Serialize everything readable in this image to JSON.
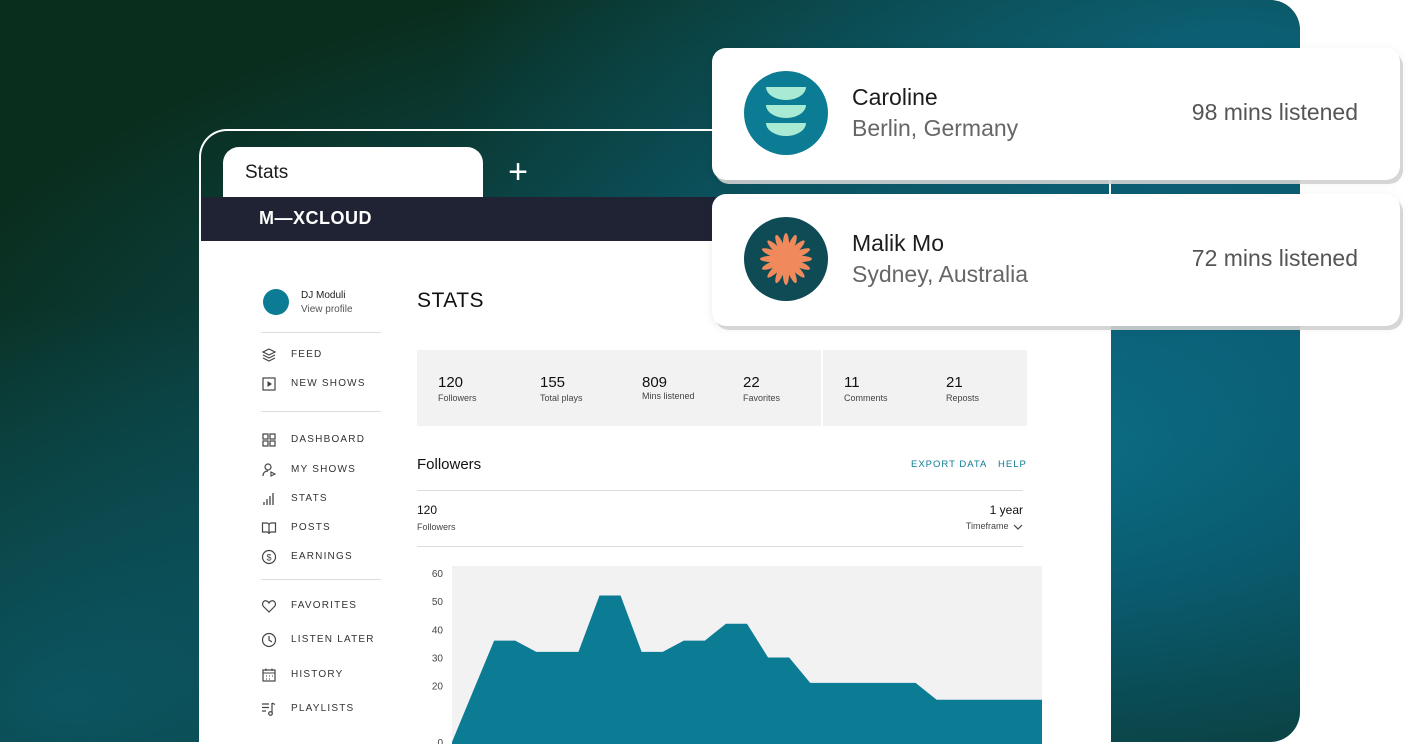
{
  "browser": {
    "tab_title": "Stats",
    "new_tab_symbol": "+"
  },
  "brand": {
    "logo_text": "M—XCLOUD"
  },
  "profile": {
    "name": "DJ Moduli",
    "link": "View profile"
  },
  "nav": {
    "group1": [
      {
        "label": "FEED",
        "icon": "layers-icon"
      },
      {
        "label": "NEW SHOWS",
        "icon": "play-square-icon"
      }
    ],
    "group2": [
      {
        "label": "DASHBOARD",
        "icon": "grid-icon"
      },
      {
        "label": "MY SHOWS",
        "icon": "user-play-icon"
      },
      {
        "label": "STATS",
        "icon": "bar-chart-icon"
      },
      {
        "label": "POSTS",
        "icon": "book-icon"
      },
      {
        "label": "EARNINGS",
        "icon": "dollar-circle-icon"
      }
    ],
    "group3": [
      {
        "label": "FAVORITES",
        "icon": "heart-icon"
      },
      {
        "label": "LISTEN LATER",
        "icon": "clock-icon"
      },
      {
        "label": "HISTORY",
        "icon": "calendar-icon"
      },
      {
        "label": "PLAYLISTS",
        "icon": "playlist-icon"
      }
    ]
  },
  "page": {
    "title": "STATS"
  },
  "stats": [
    {
      "value": "120",
      "label": "Followers"
    },
    {
      "value": "155",
      "label": "Total plays"
    },
    {
      "value": "809",
      "label": "Mins listened"
    },
    {
      "value": "22",
      "label": "Favorites"
    },
    {
      "value": "11",
      "label": "Comments"
    },
    {
      "value": "21",
      "label": "Reposts"
    }
  ],
  "followers_section": {
    "title": "Followers",
    "export_label": "EXPORT DATA",
    "help_label": "HELP",
    "count_value": "120",
    "count_label": "Followers",
    "timeframe_value": "1 year",
    "timeframe_label": "Timeframe"
  },
  "chart_data": {
    "type": "area",
    "yticks": [
      "60",
      "50",
      "40",
      "30",
      "20",
      "0"
    ],
    "ylim": [
      0,
      60
    ],
    "x": [
      0,
      1,
      2,
      3,
      4,
      5,
      6,
      7,
      8,
      9,
      10,
      11,
      12,
      13,
      14,
      15,
      16,
      17,
      18,
      19,
      20,
      21,
      22,
      23,
      24,
      25,
      26,
      27,
      28
    ],
    "values": [
      0,
      18,
      36,
      36,
      32,
      32,
      32,
      52,
      52,
      32,
      32,
      36,
      36,
      42,
      42,
      30,
      30,
      21,
      21,
      21,
      21,
      21,
      21,
      15,
      15,
      15,
      15,
      15,
      15
    ],
    "color": "#0c7b94",
    "background": "#f2f2f2"
  },
  "listeners": [
    {
      "name": "Caroline",
      "location": "Berlin, Germany",
      "minutes": "98 mins listened",
      "avatar": "stacked-bowls-icon",
      "avatar_bg": "#0c7b94"
    },
    {
      "name": "Malik Mo",
      "location": "Sydney, Australia",
      "minutes": "72 mins listened",
      "avatar": "sunburst-icon",
      "avatar_bg": "#0e4b55"
    }
  ],
  "colors": {
    "accent": "#0c7b94",
    "topbar": "#1f2333",
    "orange": "#f08a5d",
    "mint": "#a8ead3"
  }
}
